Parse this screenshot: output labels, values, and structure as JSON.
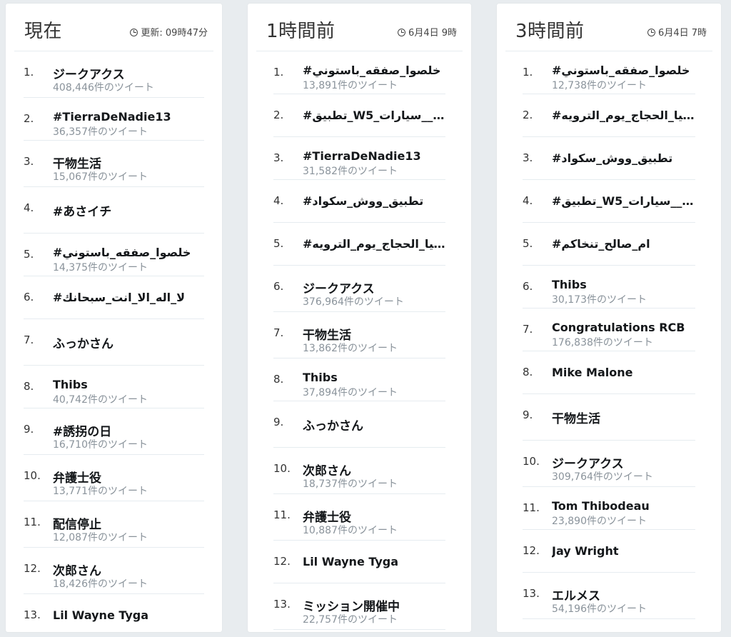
{
  "columns": [
    {
      "title": "現在",
      "meta": "更新: 09時47分",
      "items": [
        {
          "rank": "1.",
          "name": "ジークアクス",
          "count": "408,446件のツイート",
          "tall": true
        },
        {
          "rank": "2.",
          "name": "#TierraDeNadie13",
          "count": "36,357件のツイート"
        },
        {
          "rank": "3.",
          "name": "干物生活",
          "count": "15,067件のツイート",
          "tall": true
        },
        {
          "rank": "4.",
          "name": "#あさイチ",
          "count": "",
          "tall": true
        },
        {
          "rank": "5.",
          "name": "#خلصوا_صفقه_باستوني",
          "count": "14,375件のツイート"
        },
        {
          "rank": "6.",
          "name": "#لا_اله_الا_انت_سبحانك",
          "count": ""
        },
        {
          "rank": "7.",
          "name": "ふっかさん",
          "count": "",
          "tall": true
        },
        {
          "rank": "8.",
          "name": "Thibs",
          "count": "40,742件のツイート"
        },
        {
          "rank": "9.",
          "name": "#誘拐の日",
          "count": "16,710件のツイート",
          "tall": true
        },
        {
          "rank": "10.",
          "name": "弁護士役",
          "count": "13,771件のツイート",
          "tall": true
        },
        {
          "rank": "11.",
          "name": "配信停止",
          "count": "12,087件のツイート",
          "tall": true
        },
        {
          "rank": "12.",
          "name": "次郎さん",
          "count": "18,426件のツイート",
          "tall": true
        },
        {
          "rank": "13.",
          "name": "Lil Wayne Tyga",
          "count": ""
        }
      ]
    },
    {
      "title": "1時間前",
      "meta": "6月4日 9時",
      "items": [
        {
          "rank": "1.",
          "name": "#خلصوا_صفقه_باستوني",
          "count": "13,891件のツイート"
        },
        {
          "rank": "2.",
          "name": "#تطبيق_W5_احترافي__سيارات...",
          "count": ""
        },
        {
          "rank": "3.",
          "name": "#TierraDeNadie13",
          "count": "31,582件のツイート"
        },
        {
          "rank": "4.",
          "name": "#تطبيق_ووش_سكواد",
          "count": ""
        },
        {
          "rank": "5.",
          "name": "#تبرع_لسقيا_الحجاج_يوم_الترويه",
          "count": ""
        },
        {
          "rank": "6.",
          "name": "ジークアクス",
          "count": "376,964件のツイート",
          "tall": true
        },
        {
          "rank": "7.",
          "name": "干物生活",
          "count": "13,862件のツイート",
          "tall": true
        },
        {
          "rank": "8.",
          "name": "Thibs",
          "count": "37,894件のツイート"
        },
        {
          "rank": "9.",
          "name": "ふっかさん",
          "count": "",
          "tall": true
        },
        {
          "rank": "10.",
          "name": "次郎さん",
          "count": "18,737件のツイート",
          "tall": true
        },
        {
          "rank": "11.",
          "name": "弁護士役",
          "count": "10,887件のツイート",
          "tall": true
        },
        {
          "rank": "12.",
          "name": "Lil Wayne Tyga",
          "count": ""
        },
        {
          "rank": "13.",
          "name": "ミッション開催中",
          "count": "22,757件のツイート",
          "tall": true
        }
      ]
    },
    {
      "title": "3時間前",
      "meta": "6月4日 7時",
      "items": [
        {
          "rank": "1.",
          "name": "#خلصوا_صفقه_باستوني",
          "count": "12,738件のツイート"
        },
        {
          "rank": "2.",
          "name": "#تبرع_لسقيا_الحجاج_يوم_الترويه",
          "count": ""
        },
        {
          "rank": "3.",
          "name": "#تطبيق_ووش_سكواد",
          "count": ""
        },
        {
          "rank": "4.",
          "name": "#تطبيق_W5_احترافي__سيارات...",
          "count": ""
        },
        {
          "rank": "5.",
          "name": "#ام_صالح_تنخاكم",
          "count": ""
        },
        {
          "rank": "6.",
          "name": "Thibs",
          "count": "30,173件のツイート"
        },
        {
          "rank": "7.",
          "name": "Congratulations RCB",
          "count": "176,838件のツイート"
        },
        {
          "rank": "8.",
          "name": "Mike Malone",
          "count": ""
        },
        {
          "rank": "9.",
          "name": "干物生活",
          "count": "",
          "tall": true
        },
        {
          "rank": "10.",
          "name": "ジークアクス",
          "count": "309,764件のツイート",
          "tall": true
        },
        {
          "rank": "11.",
          "name": "Tom Thibodeau",
          "count": "23,890件のツイート"
        },
        {
          "rank": "12.",
          "name": "Jay Wright",
          "count": ""
        },
        {
          "rank": "13.",
          "name": "エルメス",
          "count": "54,196件のツイート",
          "tall": true
        }
      ]
    }
  ]
}
